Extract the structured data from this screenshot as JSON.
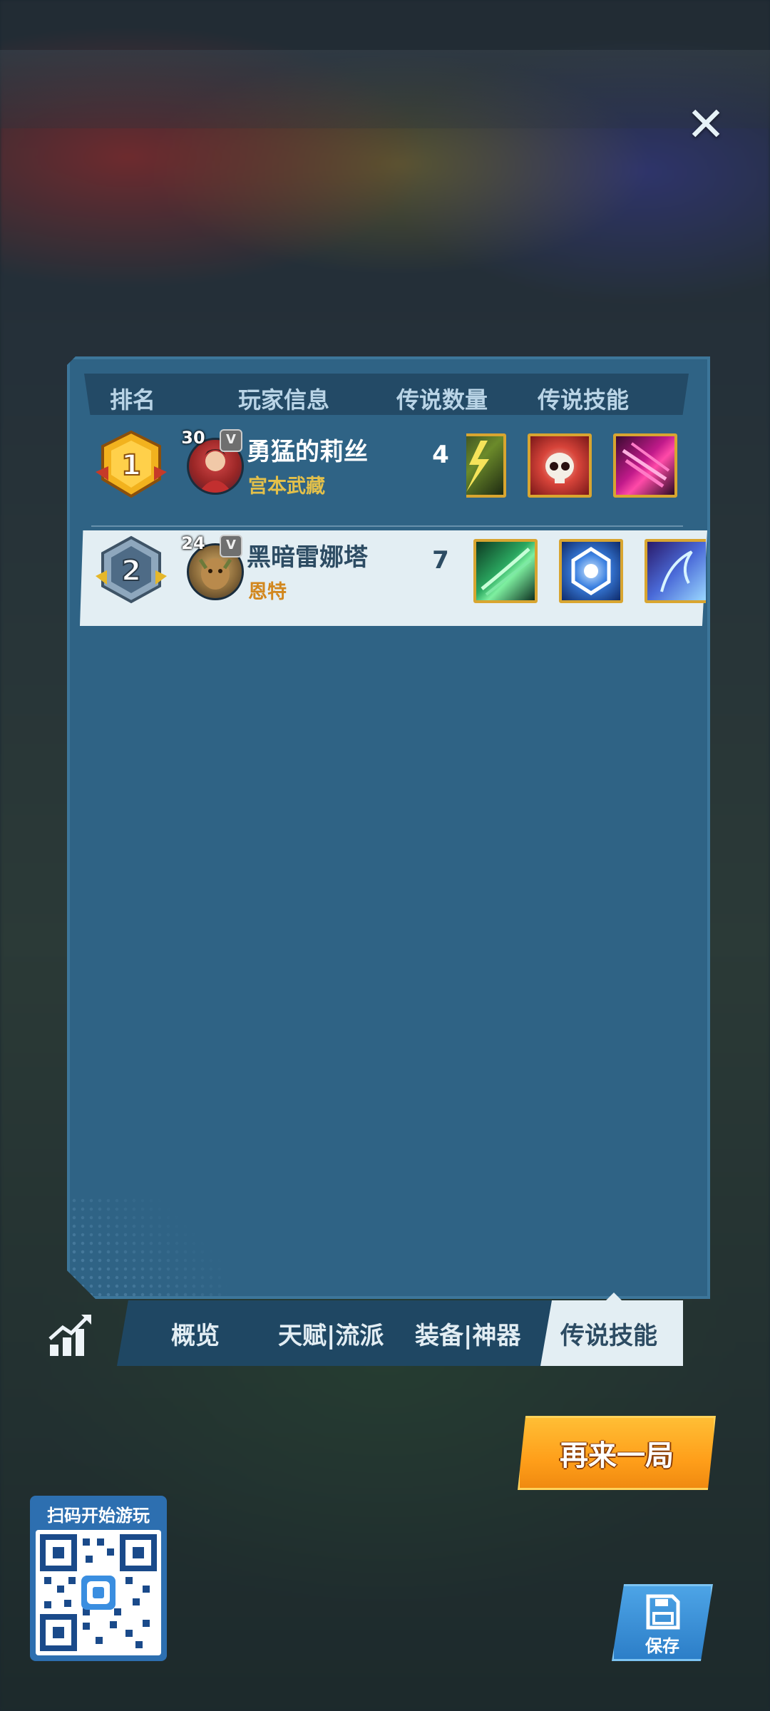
{
  "header": {
    "rank": "排名",
    "player_info": "玩家信息",
    "legend_count": "传说数量",
    "legend_skills": "传说技能"
  },
  "players": [
    {
      "rank": "1",
      "level": "30",
      "vip": "V",
      "name": "勇猛的莉丝",
      "hero": "宫本武藏",
      "legend_count": "4",
      "skill_icons": [
        "lightning-skill-icon",
        "skull-skill-icon",
        "claw-skill-icon"
      ]
    },
    {
      "rank": "2",
      "level": "24",
      "vip": "V",
      "name": "黑暗雷娜塔",
      "hero": "恩特",
      "legend_count": "7",
      "skill_icons": [
        "wind-slash-skill-icon",
        "shield-skill-icon",
        "ice-dragon-skill-icon"
      ]
    }
  ],
  "tabs": [
    "概览",
    "天赋|流派",
    "装备|神器",
    "传说技能"
  ],
  "active_tab": "传说技能",
  "buttons": {
    "play_again": "再来一局",
    "save": "保存"
  },
  "qr": {
    "title": "扫码开始游玩"
  },
  "colors": {
    "panel": "#2f6385",
    "header": "#234a66",
    "highlight_row": "#e3eef3",
    "hero_name_gold": "#e3c04a",
    "hero_name_orange": "#d2871e",
    "play_again_orange": "#ffa520",
    "skill_border_gold": "#d8a530"
  }
}
